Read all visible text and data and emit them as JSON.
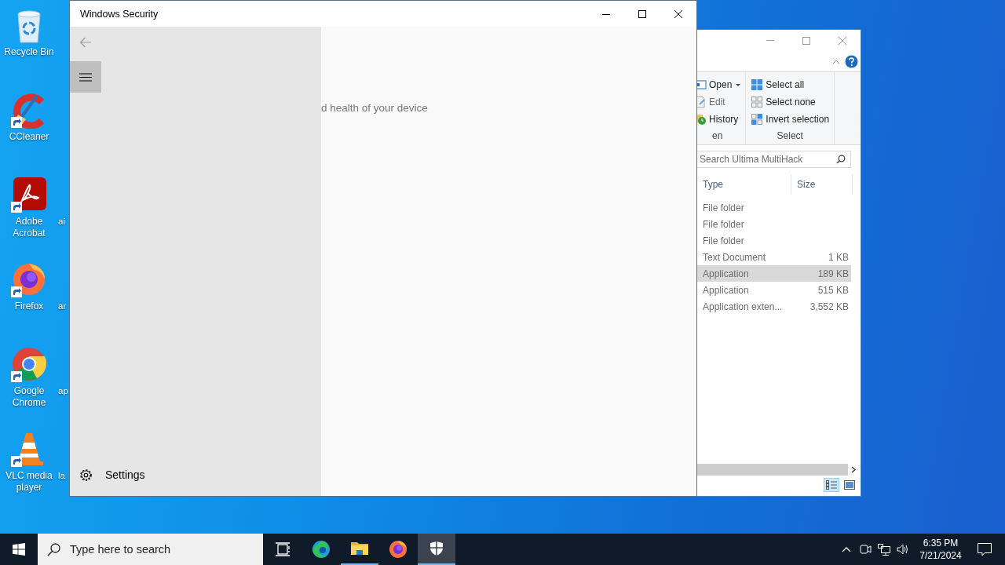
{
  "desktop_rows": [
    {
      "icon": {
        "label": "Recycle Bin",
        "kind": "recycle",
        "shortcut": false
      }
    },
    {
      "icon": {
        "label": "CCleaner",
        "kind": "ccleaner",
        "shortcut": true
      }
    },
    {
      "icon": {
        "label": "Adobe Acrobat",
        "kind": "acrobat",
        "shortcut": true
      },
      "next_label": "ai"
    },
    {
      "icon": {
        "label": "Firefox",
        "kind": "firefox",
        "shortcut": true
      },
      "next_label": "ar"
    },
    {
      "icon": {
        "label": "Google Chrome",
        "kind": "chrome",
        "shortcut": true
      },
      "next_label": "ap"
    },
    {
      "icon": {
        "label": "VLC media player",
        "kind": "vlc",
        "shortcut": true
      },
      "next_label": "la"
    }
  ],
  "explorer": {
    "ribbon": {
      "groups": [
        {
          "label": "en",
          "items": [
            {
              "label": "Open",
              "kind": "open",
              "dropdown": true
            },
            {
              "label": "Edit",
              "kind": "edit",
              "dropdown": false
            },
            {
              "label": "History",
              "kind": "history",
              "dropdown": false
            }
          ]
        },
        {
          "label": "Select",
          "items": [
            {
              "label": "Select all",
              "kind": "select_all",
              "dropdown": false
            },
            {
              "label": "Select none",
              "kind": "select_none",
              "dropdown": false
            },
            {
              "label": "Invert selection",
              "kind": "invert",
              "dropdown": false
            }
          ]
        }
      ]
    },
    "search": {
      "placeholder": "Search Ultima MultiHack"
    },
    "columns": [
      "Type",
      "Size"
    ],
    "rows": [
      {
        "type": "File folder",
        "selected": false
      },
      {
        "type": "File folder",
        "selected": false
      },
      {
        "type": "File folder",
        "selected": false
      },
      {
        "type": "Text Document",
        "size": "1 KB",
        "selected": false
      },
      {
        "type": "Application",
        "size": "189 KB",
        "selected": true
      },
      {
        "type": "Application",
        "size": "515 KB",
        "selected": false
      },
      {
        "type": "Application exten...",
        "size": "3,552 KB",
        "selected": false
      }
    ],
    "views": [
      {
        "kind": "details",
        "selected": true
      },
      {
        "kind": "thumbnails",
        "selected": false
      }
    ]
  },
  "security": {
    "window": {
      "title": "Windows Security"
    },
    "back_disabled": true,
    "settings": "Settings",
    "content_text": "d health of your device"
  },
  "taskbar": {
    "search": {
      "placeholder": "Type here to search"
    },
    "apps": [
      {
        "kind": "taskview",
        "running": false,
        "selected": false
      },
      {
        "kind": "edge",
        "running": false,
        "selected": false
      },
      {
        "kind": "explorer",
        "running": true,
        "selected": false
      },
      {
        "kind": "firefox",
        "running": false,
        "selected": false
      },
      {
        "kind": "security",
        "running": true,
        "selected": true
      }
    ],
    "clock": {
      "time": "6:35 PM",
      "date": "7/21/2024"
    }
  }
}
